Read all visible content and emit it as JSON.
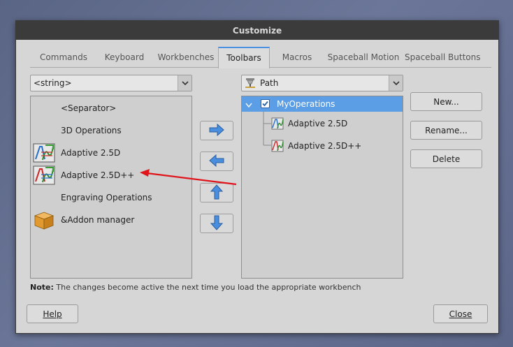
{
  "dialog": {
    "title": "Customize"
  },
  "tabs": [
    {
      "label": "Commands"
    },
    {
      "label": "Keyboard"
    },
    {
      "label": "Workbenches"
    },
    {
      "label": "Toolbars"
    },
    {
      "label": "Macros"
    },
    {
      "label": "Spaceball Motion"
    },
    {
      "label": "Spaceball Buttons"
    }
  ],
  "left_combo": {
    "value": "<string>"
  },
  "right_combo": {
    "value": "Path"
  },
  "commands": [
    {
      "label": "<Separator>",
      "icon": "none"
    },
    {
      "label": "3D Operations",
      "icon": "none"
    },
    {
      "label": "Adaptive 2.5D",
      "icon": "adaptive-icon"
    },
    {
      "label": "Adaptive 2.5D++",
      "icon": "adaptive-icon"
    },
    {
      "label": "Engraving Operations",
      "icon": "none"
    },
    {
      "label": "&Addon manager",
      "icon": "package-icon"
    }
  ],
  "toolbar_tree": {
    "root": {
      "label": "MyOperations",
      "checked": true
    },
    "children": [
      {
        "label": "Adaptive 2.5D"
      },
      {
        "label": "Adaptive 2.5D++"
      }
    ]
  },
  "side_buttons": {
    "new": "New...",
    "rename": "Rename...",
    "delete": "Delete"
  },
  "note": {
    "prefix": "Note:",
    "text": "The changes become active the next time you load the appropriate workbench"
  },
  "footer": {
    "help": "Help",
    "close": "Close"
  },
  "colors": {
    "accent": "#4a90e2",
    "selection": "#5b9ee6",
    "annotation_arrow": "#e0141b"
  }
}
